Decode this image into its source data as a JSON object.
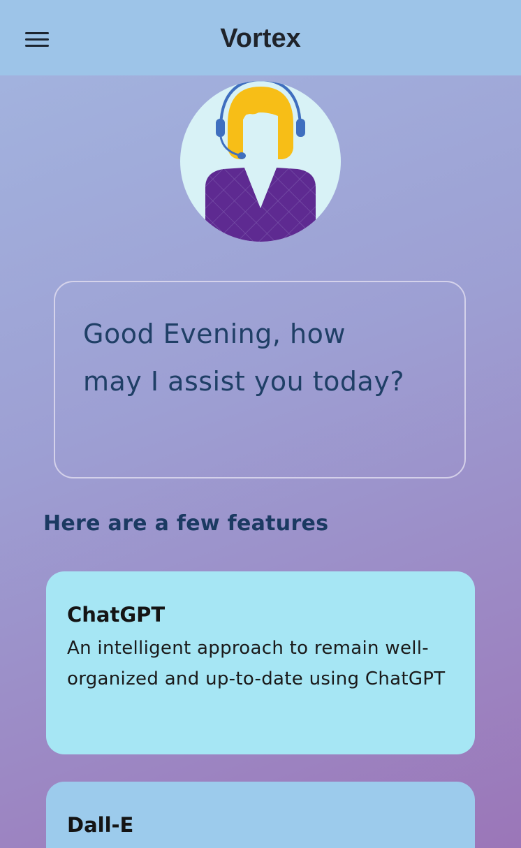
{
  "app_bar": {
    "title": "Vortex",
    "menu_icon": "hamburger-menu-icon"
  },
  "avatar": {
    "icon": "support-agent-headset-icon",
    "colors": {
      "background": "#d8f2f6",
      "hair": "#f7be17",
      "headset": "#3f6fbf",
      "shirt": "#5e2a91"
    }
  },
  "greeting": {
    "text": "Good Evening, how may I assist you today?"
  },
  "features": {
    "heading": "Here are a few features",
    "items": [
      {
        "title": "ChatGPT",
        "description": "An intelligent approach to remain well-organized and up-to-date using ChatGPT",
        "color": "#a6e6f4"
      },
      {
        "title": "Dall-E",
        "description": "",
        "color": "#9ccbec"
      }
    ]
  },
  "colors": {
    "app_bar": "#9dc4e8",
    "text_dark_blue": "#1f3f66"
  }
}
